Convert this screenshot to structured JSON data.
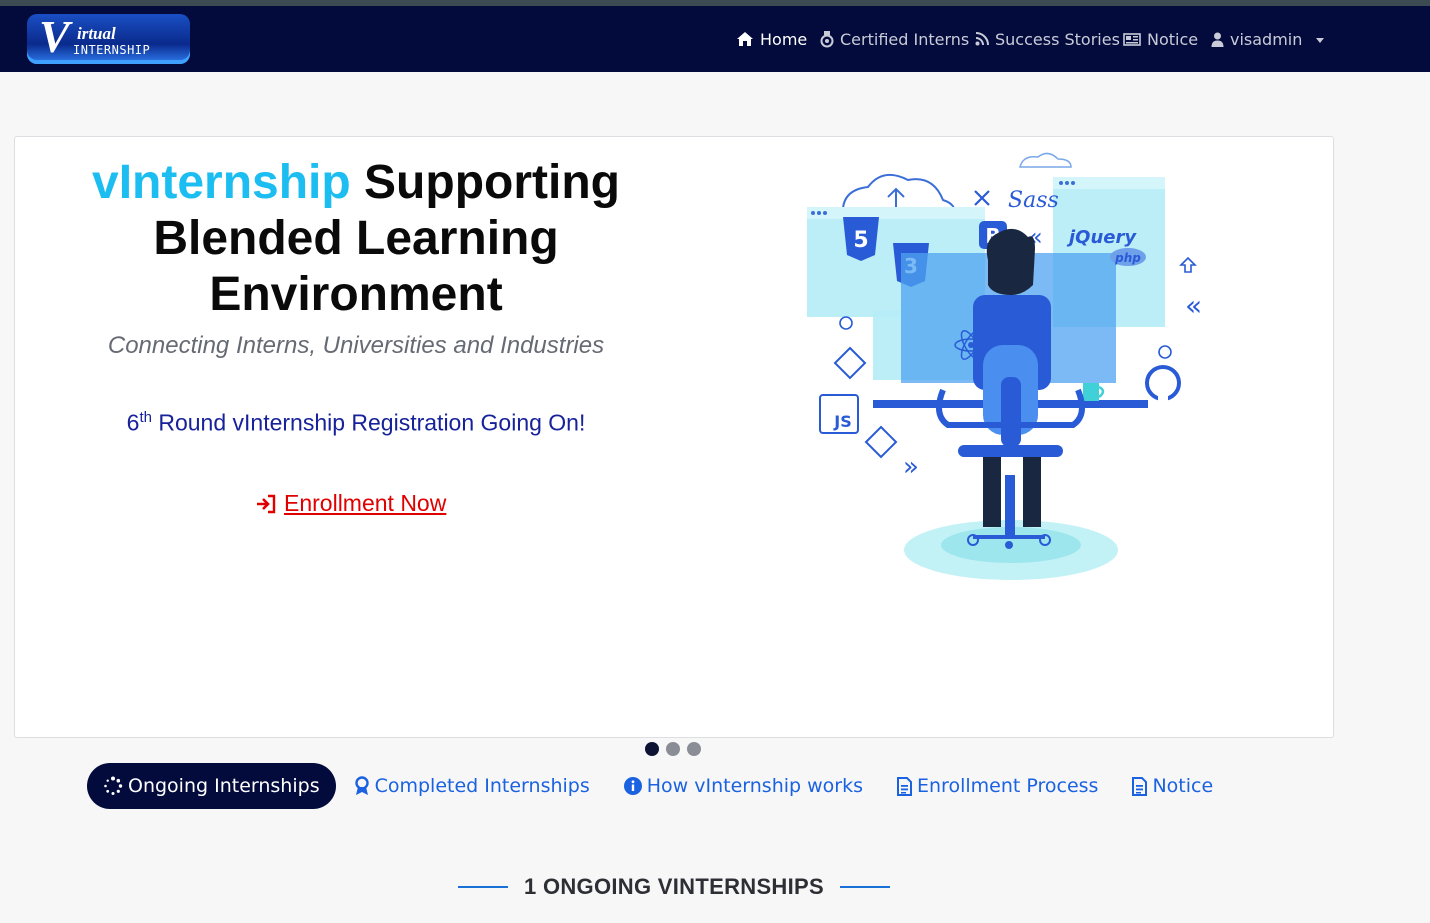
{
  "brand": {
    "logo_v": "V",
    "logo_top": "irtual",
    "logo_bottom": "INTERNSHIP"
  },
  "nav": {
    "home": "Home",
    "certified": "Certified Interns",
    "success": "Success Stories",
    "notice": "Notice",
    "user": "visadmin"
  },
  "hero": {
    "title_accent": "vInternship",
    "title_rest": " Supporting Blended Learning Environment",
    "subtitle": "Connecting Interns, Universities and Industries",
    "round_number": "6",
    "round_suffix": "th",
    "round_rest": " Round vInternship Registration Going On!",
    "enroll_label": "Enrollment Now"
  },
  "carousel": {
    "slide_count": 3,
    "active_index": 0
  },
  "tabs": [
    {
      "label": "Ongoing Internships",
      "icon": "spinner-icon",
      "active": true
    },
    {
      "label": "Completed Internships",
      "icon": "award-icon",
      "active": false
    },
    {
      "label": "How vInternship works",
      "icon": "info-circle-icon",
      "active": false
    },
    {
      "label": "Enrollment Process",
      "icon": "document-icon",
      "active": false
    },
    {
      "label": "Notice",
      "icon": "document-icon",
      "active": false
    }
  ],
  "section": {
    "title": "1 ONGOING VINTERNSHIPS"
  },
  "colors": {
    "navbar": "#030a3c",
    "accent_cyan": "#1cbdf0",
    "link_blue": "#1a62e0",
    "enroll_red": "#e00000"
  }
}
